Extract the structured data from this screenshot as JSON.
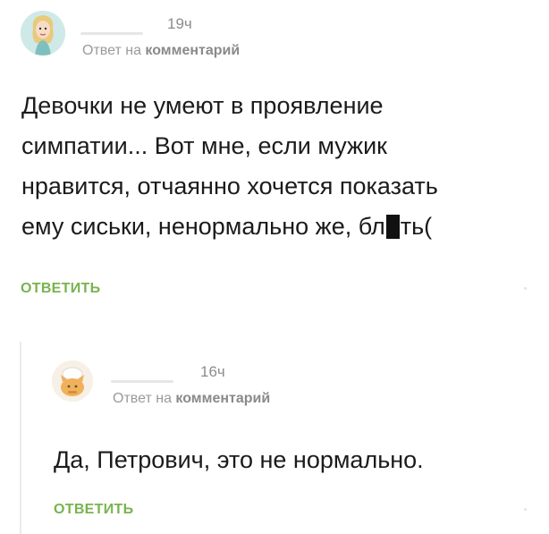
{
  "comments": [
    {
      "time": "19ч",
      "reply_prefix": "Ответ на",
      "reply_target": "комментарий",
      "text_lines": [
        "Девочки не умеют в проявление",
        "симпатии... Вот мне, если мужик",
        "нравится, отчаянно хочется показать"
      ],
      "last_line_before": "ему сиськи, ненормально же, бл",
      "last_line_after": "ть(",
      "reply_label": "ОТВЕТИТЬ"
    },
    {
      "time": "16ч",
      "reply_prefix": "Ответ на",
      "reply_target": "комментарий",
      "text": "Да, Петрович, это не нормально.",
      "reply_label": "ОТВЕТИТЬ"
    }
  ],
  "colors": {
    "accent": "#79b34f",
    "meta": "#9a9a9a",
    "text": "#1b1b1b"
  },
  "icons": {
    "avatar1": "girl-avatar-icon",
    "avatar2": "cat-avatar-icon"
  }
}
